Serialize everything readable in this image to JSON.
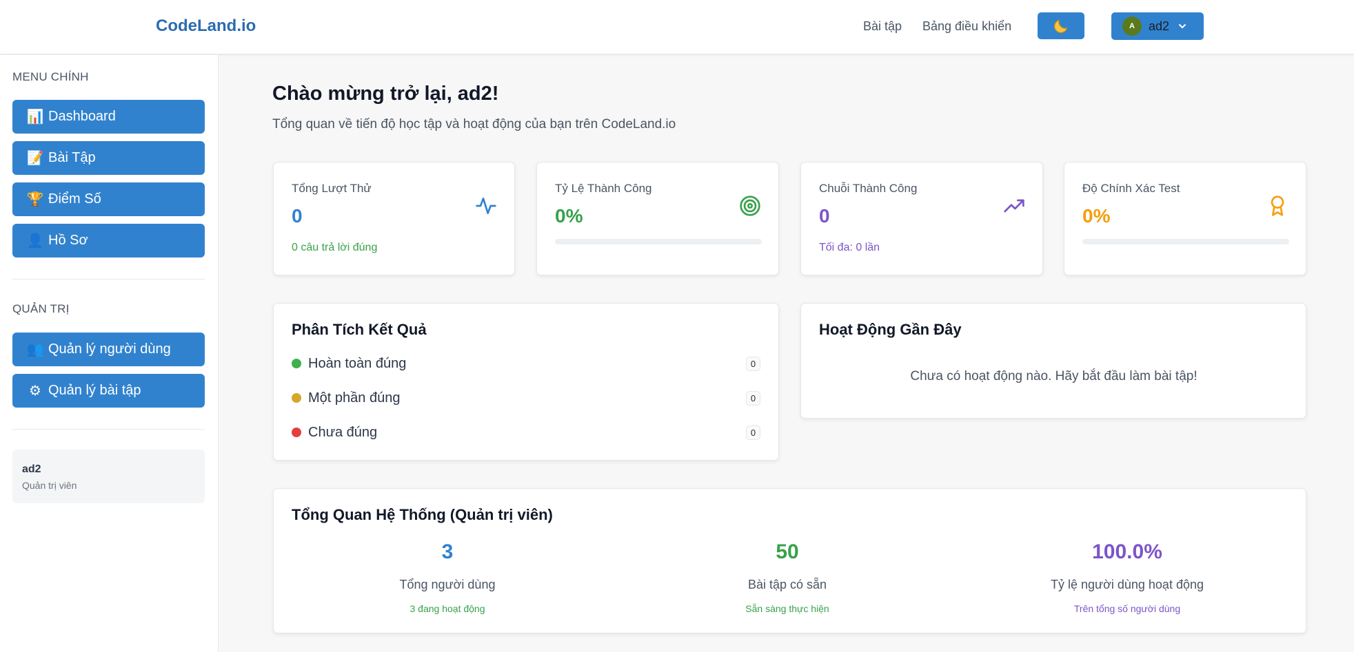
{
  "colors": {
    "primary": "#3182ce",
    "brand": "#2b6cb0",
    "blue": "#3182ce",
    "green": "#38a14b",
    "purple": "#7c55c9",
    "orange": "#f59e0b",
    "dot_correct": "#3fb04d",
    "dot_partial": "#d4a72c",
    "dot_wrong": "#e53e3e"
  },
  "header": {
    "brand": "CodeLand.io",
    "nav": {
      "exercises": "Bài tập",
      "dashboard": "Bảng điều khiển"
    },
    "theme_icon": "moon-icon",
    "user": {
      "initial": "A",
      "name": "ad2"
    }
  },
  "sidebar": {
    "main_label": "MENU CHÍNH",
    "main_items": [
      {
        "icon": "📊",
        "label": "Dashboard"
      },
      {
        "icon": "📝",
        "label": "Bài Tập"
      },
      {
        "icon": "🏆",
        "label": "Điểm Số"
      },
      {
        "icon": "👤",
        "label": "Hồ Sơ"
      }
    ],
    "admin_label": "QUẢN TRỊ",
    "admin_items": [
      {
        "icon": "👥",
        "label": "Quản lý người dùng"
      },
      {
        "icon": "⚙",
        "label": "Quản lý bài tập"
      }
    ],
    "user_card": {
      "name": "ad2",
      "role": "Quản trị viên"
    }
  },
  "main": {
    "welcome": "Chào mừng trở lại, ad2!",
    "subtitle": "Tổng quan về tiến độ học tập và hoạt động của bạn trên CodeLand.io",
    "stats": [
      {
        "label": "Tổng Lượt Thử",
        "value": "0",
        "sub": "0 câu trả lời đúng",
        "icon": "activity-icon"
      },
      {
        "label": "Tỷ Lệ Thành Công",
        "value": "0%",
        "progress": 0,
        "icon": "target-icon"
      },
      {
        "label": "Chuỗi Thành Công",
        "value": "0",
        "sub": "Tối đa: 0 lần",
        "icon": "trending-up-icon"
      },
      {
        "label": "Độ Chính Xác Test",
        "value": "0%",
        "progress": 0,
        "icon": "award-icon"
      }
    ],
    "analysis": {
      "title": "Phân Tích Kết Quả",
      "rows": [
        {
          "label": "Hoàn toàn đúng",
          "count": "0"
        },
        {
          "label": "Một phần đúng",
          "count": "0"
        },
        {
          "label": "Chưa đúng",
          "count": "0"
        }
      ]
    },
    "activity": {
      "title": "Hoạt Động Gần Đây",
      "empty": "Chưa có hoạt động nào. Hãy bắt đầu làm bài tập!"
    },
    "system": {
      "title": "Tổng Quan Hệ Thống (Quản trị viên)",
      "items": [
        {
          "value": "3",
          "label": "Tổng người dùng",
          "sub": "3 đang hoạt động"
        },
        {
          "value": "50",
          "label": "Bài tập có sẵn",
          "sub": "Sẵn sàng thực hiện"
        },
        {
          "value": "100.0%",
          "label": "Tỷ lệ người dùng hoạt động",
          "sub": "Trên tổng số người dùng"
        }
      ]
    }
  }
}
